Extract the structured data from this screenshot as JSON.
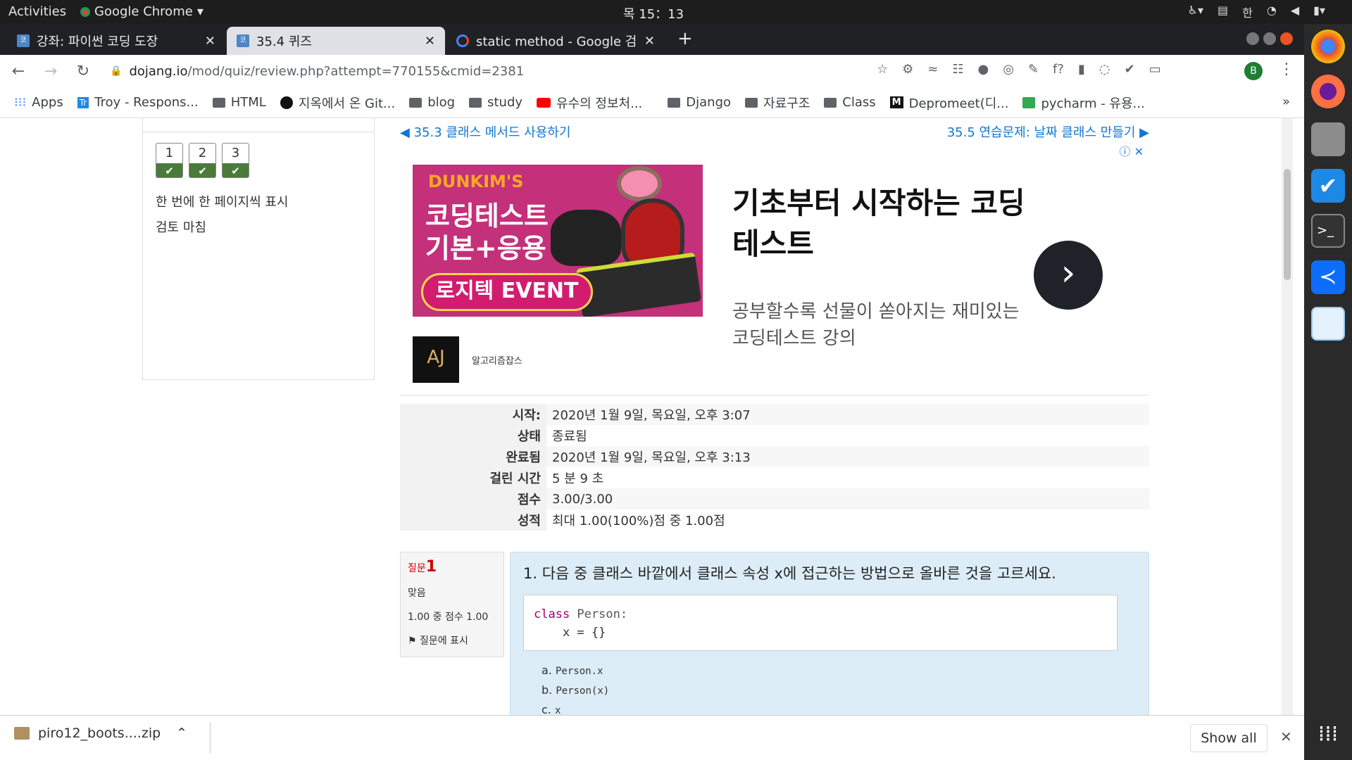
{
  "system": {
    "activities": "Activities",
    "app_name": "Google Chrome",
    "clock": "목 15：13",
    "input_method": "한"
  },
  "browser": {
    "tabs": [
      {
        "label": "강좌: 파이썬 코딩 도장"
      },
      {
        "label": "35.4 퀴즈"
      },
      {
        "label": "static method - Google 검"
      }
    ],
    "url_domain": "dojang.io",
    "url_path": "/mod/quiz/review.php?attempt=770155&cmid=2381",
    "profile_initial": "B",
    "bookmarks": [
      "Apps",
      "Troy - Respons...",
      "HTML",
      "지옥에서 온 Git...",
      "blog",
      "study",
      "유수의 정보처...",
      "Django",
      "자료구조",
      "Class",
      "Depromeet(디...",
      "pycharm - 유용..."
    ],
    "bookmarks_overflow": "»"
  },
  "quiz_nav": {
    "questions": [
      "1",
      "2",
      "3"
    ],
    "show_one_page": "한 번에 한 페이지씩 표시",
    "finish_review": "검토 마침"
  },
  "page_nav": {
    "prev": "◀ 35.3 클래스 메서드 사용하기",
    "next": "35.5 연습문제: 날짜 클래스 만들기 ▶"
  },
  "ad": {
    "brand": "DUNKIM'S",
    "image_line1": "코딩테스트",
    "image_line2": "기본+응용",
    "event": "로지텍 EVENT",
    "logo_text": "AJ",
    "advertiser": "알고리즘잡스",
    "title": "기초부터 시작하는 코딩테스트",
    "subtitle": "공부할수록 선물이 쏟아지는 재미있는 코딩테스트 강의",
    "info_icons": "ⓘ ✕"
  },
  "summary": [
    {
      "label": "시작:",
      "value": "2020년 1월 9일, 목요일, 오후 3:07"
    },
    {
      "label": "상태",
      "value": "종료됨"
    },
    {
      "label": "완료됨",
      "value": "2020년 1월 9일, 목요일, 오후 3:13"
    },
    {
      "label": "걸린 시간",
      "value": "5 분 9 초"
    },
    {
      "label": "점수",
      "value": "3.00/3.00"
    },
    {
      "label": "성적",
      "value": "최대 1.00(100%)점 중 1.00점"
    }
  ],
  "question": {
    "label": "질문",
    "number": "1",
    "status": "맞음",
    "score": "1.00 중 점수 1.00",
    "flag": "질문에 표시",
    "text": "1. 다음 중 클래스 바깥에서 클래스 속성 x에 접근하는 방법으로 올바른 것을 고르세요.",
    "code_kw": "class",
    "code_line1_rest": " Person:",
    "code_line2": "    x = {}",
    "answers": [
      {
        "letter": "a.",
        "text": "Person.x"
      },
      {
        "letter": "b.",
        "text": "Person(x)"
      },
      {
        "letter": "c.",
        "text": "x"
      }
    ]
  },
  "downloads": {
    "file": "piro12_boots....zip",
    "show_all": "Show all"
  }
}
